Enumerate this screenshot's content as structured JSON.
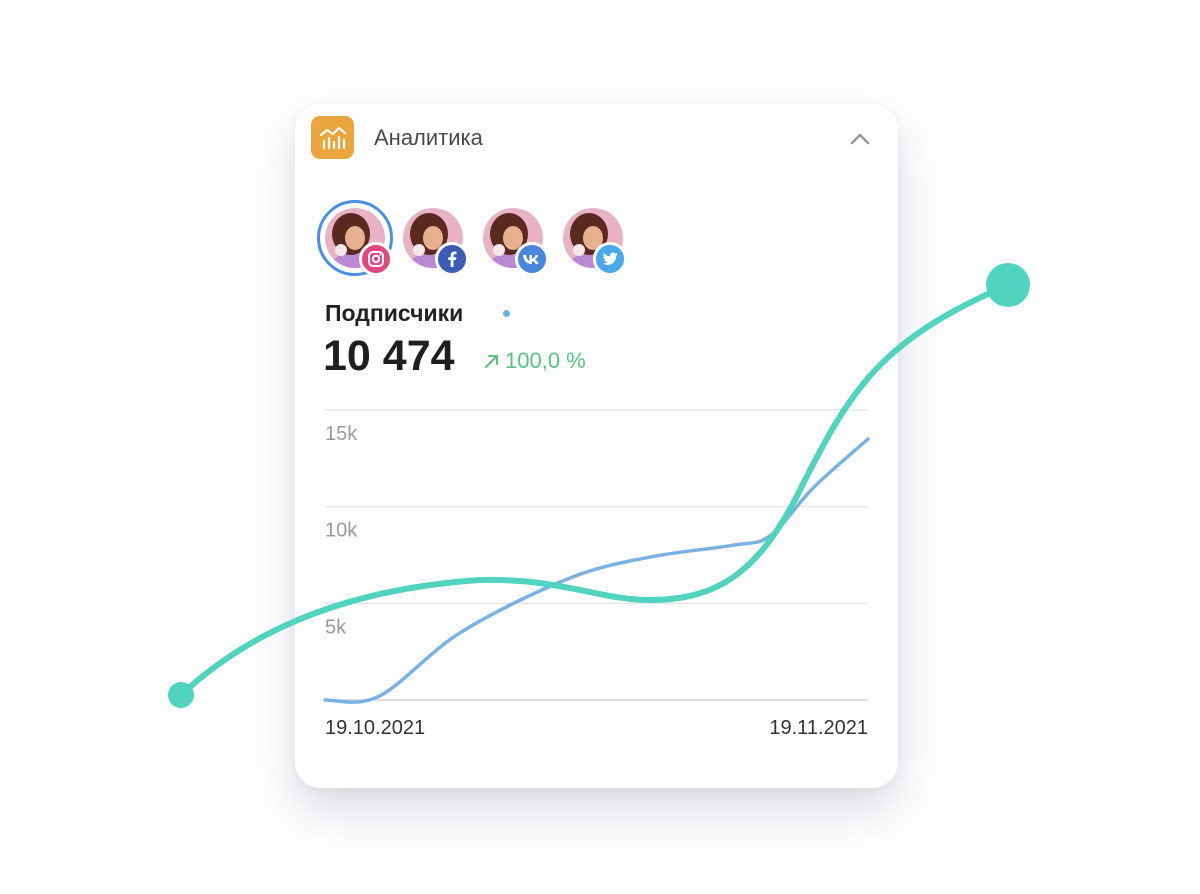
{
  "header": {
    "title": "Аналитика",
    "app_icon": "analytics-chart-icon",
    "collapse_icon": "chevron-up-icon",
    "accent_color": "#eaa53c"
  },
  "profiles": [
    {
      "network": "instagram",
      "icon": "instagram-icon",
      "selected": true
    },
    {
      "network": "facebook",
      "icon": "facebook-icon",
      "selected": false
    },
    {
      "network": "vk",
      "icon": "vk-icon",
      "selected": false
    },
    {
      "network": "twitter",
      "icon": "twitter-icon",
      "selected": false
    }
  ],
  "metric": {
    "label": "Подписчики",
    "value": "10 474",
    "change": "100,0 %",
    "change_color": "#58c281"
  },
  "chart_data": {
    "type": "line",
    "y_ticks": [
      "15k",
      "10k",
      "5k"
    ],
    "ylim": [
      0,
      15000
    ],
    "x_start_label": "19.10.2021",
    "x_end_label": "19.11.2021",
    "grid": true,
    "series": [
      {
        "color": "#7ab2e2",
        "x": [
          0,
          0.1,
          0.25,
          0.45,
          0.6,
          0.75,
          0.82,
          0.9,
          1.0
        ],
        "values": [
          0,
          200,
          3500,
          6300,
          7400,
          8000,
          8500,
          11000,
          13500
        ]
      }
    ]
  }
}
